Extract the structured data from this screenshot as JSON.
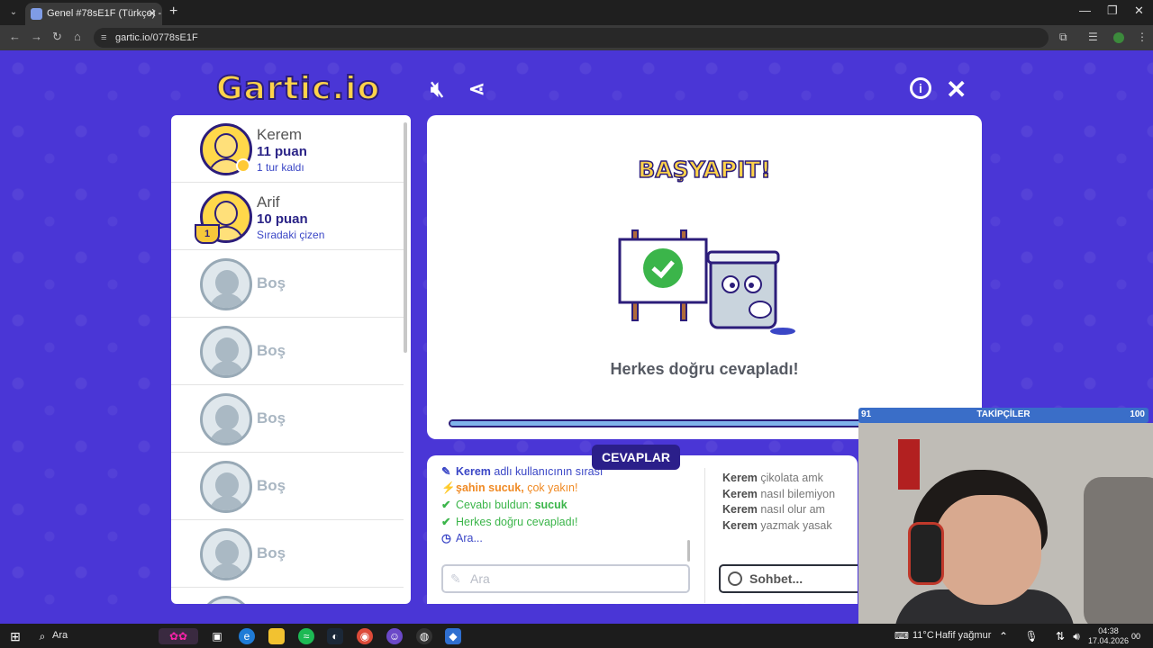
{
  "browser": {
    "tab_title": "Genel #78sE1F (Türkçe) - Gartic",
    "tab_close": "✕",
    "new_tab": "+",
    "url": "gartic.io/0778sE1F",
    "window_controls": [
      "—",
      "❐",
      "✕"
    ]
  },
  "game": {
    "logo": "Gartic.io",
    "header_icons": [
      "mute-icon",
      "share-icon",
      "info-icon",
      "close-icon"
    ],
    "players": [
      {
        "name": "Kerem",
        "points": "11 puan",
        "status": "1 tur kaldı",
        "empty": false
      },
      {
        "name": "Arif",
        "points": "10 puan",
        "status": "Sıradaki çizen",
        "empty": false,
        "trophy": "1"
      },
      {
        "name": "Boş",
        "empty": true
      },
      {
        "name": "Boş",
        "empty": true
      },
      {
        "name": "Boş",
        "empty": true
      },
      {
        "name": "Boş",
        "empty": true
      },
      {
        "name": "Boş",
        "empty": true
      }
    ],
    "result": {
      "title": "BAŞYAPIT!",
      "message": "Herkes doğru cevapladı!",
      "progress": 0.92
    },
    "answers_tab": "CEVAPLAR",
    "answers": [
      {
        "icon": "✎",
        "color": "#3a46c6",
        "bold": "Kerem",
        "text": " adlı kullanıcının sırası"
      },
      {
        "icon": "⚡",
        "color": "#f08a24",
        "bold": "şahin sucuk,",
        "text": " çok yakın!"
      },
      {
        "icon": "✔",
        "color": "#3bb54a",
        "bold": "",
        "text": "Cevabı buldun: ",
        "tail": "sucuk"
      },
      {
        "icon": "✔",
        "color": "#3bb54a",
        "bold": "",
        "text": "Herkes doğru cevapladı!"
      },
      {
        "icon": "◷",
        "color": "#3a46c6",
        "bold": "",
        "text": "Ara..."
      }
    ],
    "answer_placeholder": "Ara",
    "chat": [
      {
        "user": "Kerem",
        "text": "çikolata amk"
      },
      {
        "user": "Kerem",
        "text": "nasıl bilemiyon"
      },
      {
        "user": "Kerem",
        "text": "nasıl olur am"
      },
      {
        "user": "Kerem",
        "text": "yazmak yasak"
      }
    ],
    "chat_placeholder": "Sohbet..."
  },
  "overlay": {
    "followers_current": "91",
    "followers_label": "TAKİPÇİLER",
    "followers_goal": "100",
    "followers_progress": 0.91
  },
  "taskbar": {
    "search": "Ara",
    "weather_temp": "11°C",
    "weather_desc": "Hafif yağmur",
    "time": "04:38",
    "date": "17.04.2026",
    "notifications": "00"
  },
  "colors": {
    "game_bg": "#4a36d6",
    "accent": "#2b1f8a",
    "logo": "#ffd34a"
  }
}
